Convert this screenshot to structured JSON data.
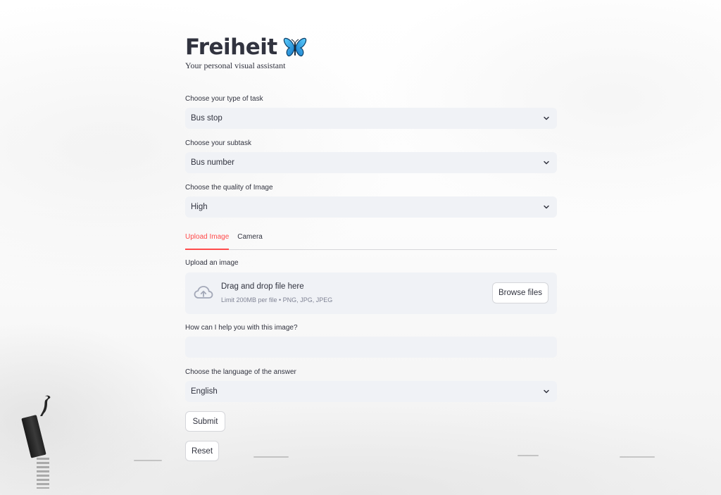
{
  "header": {
    "title": "Freiheit",
    "subtitle": "Your personal visual assistant",
    "title_icon": "butterfly-icon"
  },
  "task_select": {
    "label": "Choose your type of task",
    "value": "Bus stop"
  },
  "subtask_select": {
    "label": "Choose your subtask",
    "value": "Bus number"
  },
  "quality_select": {
    "label": "Choose the quality of Image",
    "value": "High"
  },
  "tabs": [
    {
      "label": "Upload Image",
      "active": true
    },
    {
      "label": "Camera",
      "active": false
    }
  ],
  "uploader": {
    "label": "Upload an image",
    "drop_title": "Drag and drop file here",
    "drop_sub": "Limit 200MB per file • PNG, JPG, JPEG",
    "browse_label": "Browse files",
    "icon": "cloud-upload-icon"
  },
  "question": {
    "label": "How can I help you with this image?",
    "value": "",
    "placeholder": ""
  },
  "language_select": {
    "label": "Choose the language of the answer",
    "value": "English"
  },
  "actions": {
    "submit_label": "Submit",
    "reset_label": "Reset"
  },
  "colors": {
    "accent": "#ff4b4b",
    "input_bg": "#f0f2f6",
    "text": "#31333f",
    "muted": "#808495"
  }
}
